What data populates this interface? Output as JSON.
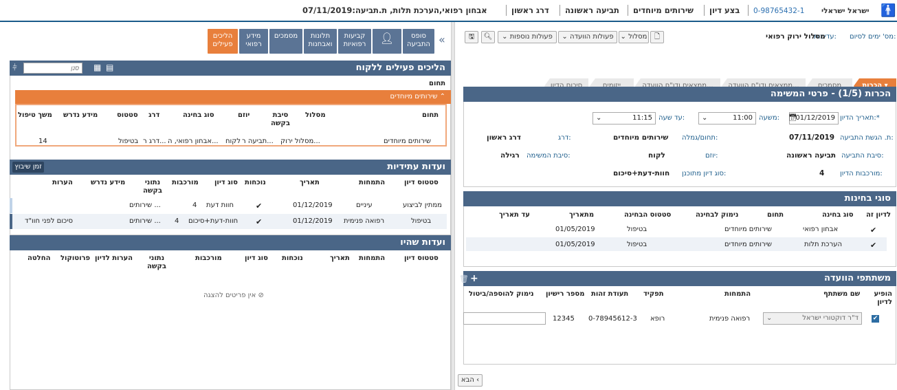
{
  "topbar": {
    "patient_name": "ישראל ישראלי",
    "patient_id": "0-98765432-1",
    "items": [
      "בצע דיון",
      "שירותים מיוחדים",
      "תביעה ראשונה",
      "דרג ראשון"
    ],
    "title_text": "אבחון רפואי,הערכת תלות, ת.תביעה:07/11/2019"
  },
  "left": {
    "meta": {
      "days_label": "מס' ימים לסיום:",
      "priority_label": "עדיפות:",
      "track_label": "מסלול ירוק רפואי"
    },
    "toolbar": {
      "track_btn": "מסלול",
      "committee_btn": "פעולות הוועדה",
      "more_btn": "פעולות נוספות"
    },
    "steps": [
      "הכרות",
      "מסמכים",
      "ממצאים ודו\"ח הוועדה...",
      "ממצאים ודו\"ח הוועדה...",
      "ייזומים",
      "סיכום הדיון"
    ],
    "details": {
      "title": "הכרות (1/5) - פרטי המשימה",
      "date_label": "תאריך הדיון:*",
      "date_value": "01/12/2019",
      "from_label": "משעה:",
      "from_value": "11:00",
      "to_label": "עד שעה:",
      "to_value": "11:15",
      "claim_date_label": "ת. הגשת התביעה:",
      "claim_date_value": "07/11/2019",
      "domain_label": "תחום/גמלה:",
      "domain_value": "שירותים מיוחדים",
      "rank_label": "דרג:",
      "rank_value": "דרג ראשון",
      "reason_label": "סיבת התביעה:",
      "reason_value": "תביעה ראשונה",
      "initiator_label": "יוזם:",
      "initiator_value": "לקוח",
      "task_reason_label": "סיבת המשימה:",
      "task_reason_value": "רגילה",
      "complexity_label": "מורכבות הדיון:",
      "complexity_value": "4",
      "planned_type_label": "סוג דיון מתוכנן:",
      "planned_type_value": "חוות-דעת+סיכום"
    },
    "tests": {
      "title": "סוגי בחינות",
      "headers": [
        "לדיון זה",
        "סוג בחינה",
        "תחום",
        "נימוק לבחינה",
        "סטטוס הבחינה",
        "מתאריך",
        "עד תאריך"
      ],
      "rows": [
        {
          "type": "אבחון רפואי",
          "domain": "שירותים מיוחדים",
          "status": "בטיפול",
          "from": "01/05/2019"
        },
        {
          "type": "הערכת תלות",
          "domain": "שירותים מיוחדים",
          "status": "בטיפול",
          "from": "01/05/2019"
        }
      ]
    },
    "participants": {
      "title": "משתתפי הוועדה",
      "headers": [
        "הופיע לדיון",
        "שם משתתף",
        "התמחות",
        "תפקיד",
        "תעודת זהות",
        "מספר רישיון",
        "נימוק להוספה/ביטול"
      ],
      "row": {
        "name": "ד\"ר דוקטורי ישראל",
        "specialty": "רפואה פנימית",
        "role": "רופא",
        "id": "0-78945612-3",
        "license": "12345"
      }
    },
    "next_btn": "הבא"
  },
  "right": {
    "tiles": [
      {
        "label": "סופס התביעה"
      },
      {
        "label": ""
      },
      {
        "label": "קביעות רפואיות"
      },
      {
        "label": "תלונות ואבחנות"
      },
      {
        "label": "מסמכים"
      },
      {
        "label": "מידע רפואי"
      },
      {
        "label": "הליכים פעילים"
      }
    ],
    "active_procs": {
      "title": "הליכים פעילים ללקוח",
      "search_placeholder": "סנן",
      "domain_hdr": "תחום",
      "group": "שירותים מיוחדים",
      "headers": [
        "תחום",
        "מסלול",
        "סיבת בקשה",
        "יוזם",
        "סוג בחינה",
        "דרג",
        "סטטוס",
        "מידע נדרש",
        "משך טיפול"
      ],
      "row": {
        "domain": "שירותים מיוחדים",
        "track": "מסלול ירוק...",
        "reason": "תביעה ר...",
        "initiator": "לקוח",
        "test": "אבחון רפואי, ה...",
        "rank": "דרג ר...",
        "status": "בטיפול",
        "duration": "14"
      }
    },
    "future": {
      "title": "ועדות עתידיות",
      "sched_btn": "זמן שיבוץ",
      "headers": [
        "סטטוס דיון",
        "התמחות",
        "תאריך",
        "נוכחות",
        "סוג דיון",
        "מורכבות",
        "נתוני בקשה",
        "מידע נדרש",
        "הערות"
      ],
      "rows": [
        {
          "status": "ממתין לביצוע",
          "spec": "עיניים",
          "date": "01/12/2019",
          "type": "חוות דעת",
          "complex": "4",
          "data": "שירותים ...",
          "notes": ""
        },
        {
          "status": "בטיפול",
          "spec": "רפואה פנימית",
          "date": "01/12/2019",
          "type": "חוות-דעת+סיכום",
          "complex": "4",
          "data": "שירותים ...",
          "notes": "סיכום לפני חוו\"ד"
        }
      ]
    },
    "past": {
      "title": "ועדות שהיו",
      "headers": [
        "סטטוס דיון",
        "התמחות",
        "תאריך",
        "נוכחות",
        "סוג דיון",
        "מורכבות",
        "נתוני בקשה",
        "הערות לדיון",
        "פרוטוקול",
        "החלטה"
      ],
      "empty": "אין פריטים להצגה"
    }
  }
}
